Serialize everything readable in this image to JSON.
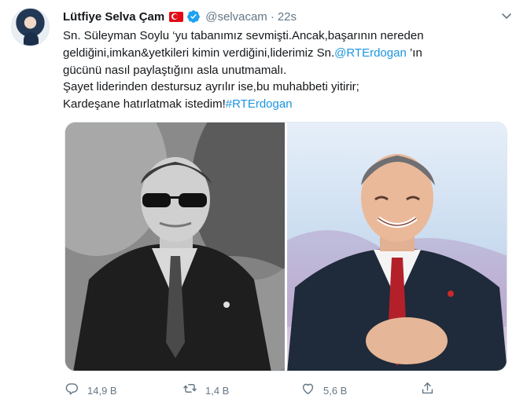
{
  "author": {
    "display_name": "Lütfiye Selva Çam",
    "handle": "@selvacam",
    "separator": "·",
    "time": "22s"
  },
  "tweet": {
    "lines": [
      "Sn. Süleyman Soylu ‘yu tabanımız sevmişti.Ancak,başarının nereden",
      "geldiğini,imkan&yetkileri kimin verdiğini,liderimiz Sn.",
      "gücünü nasıl paylaştığını asla unutmamalı.",
      "Şayet liderinden destursuz ayrılır ise,bu muhabbeti yitirir;",
      "Kardeşane hatırlatmak istedim!"
    ],
    "mention": "@RTErdogan",
    "after_mention": " ’ın",
    "hashtag": "#RTErdogan"
  },
  "actions": {
    "reply_count": "14,9 B",
    "retweet_count": "1,4 B",
    "like_count": "5,6 B"
  },
  "icons": {
    "verified": "verified-badge-icon",
    "flag": "turkey-flag-icon",
    "more": "chevron-down-icon",
    "reply": "reply-icon",
    "retweet": "retweet-icon",
    "like": "heart-icon",
    "share": "share-icon"
  },
  "colors": {
    "link": "#1b95e0",
    "secondary_text": "#657786",
    "primary_text": "#14171a",
    "verified": "#1da1f2"
  }
}
